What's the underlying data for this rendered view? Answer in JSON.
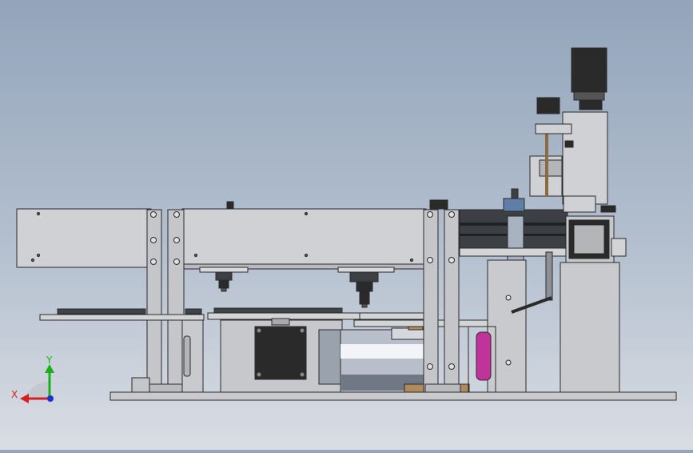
{
  "viewport": {
    "background_top": "#93a4bb",
    "background_bottom": "#d9dde4"
  },
  "colors": {
    "part_fill": "#c9cbce",
    "part_light": "#dcdee0",
    "part_dark": "#8d9095",
    "edge": "#2b2b2b",
    "motor_black": "#2a2a2a",
    "rail_dark": "#3c3f44",
    "cylinder": "#b8bfca",
    "brass": "#b08a5c",
    "magenta": "#c0339a",
    "axis_x": "#d62020",
    "axis_y": "#19b019",
    "axis_origin": "#2030d0"
  },
  "triad": {
    "x_label": "X",
    "y_label": "Y"
  }
}
